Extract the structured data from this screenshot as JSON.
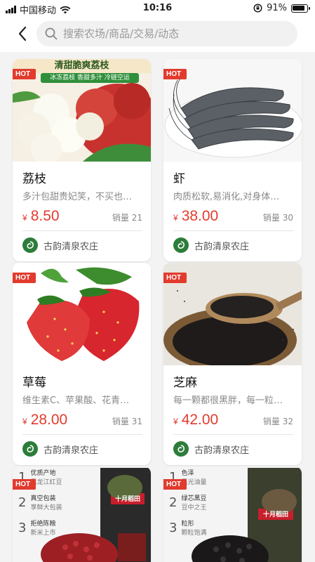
{
  "status_bar": {
    "carrier": "中国移动",
    "time": "10:16",
    "battery": "91%"
  },
  "header": {
    "search_placeholder": "搜索农场/商品/交易/动态"
  },
  "products": [
    {
      "badge": "HOT",
      "name": "荔枝",
      "desc": "多汁包甜贵妃笑，不买也…",
      "price_symbol": "¥",
      "price": "8.50",
      "sales": "销量 21",
      "farm": "古韵清泉农庄",
      "banner_title": "清甜脆爽荔枝",
      "banner_sub": "冰冻荔枝 香甜多汁 冷链空运"
    },
    {
      "badge": "HOT",
      "name": "虾",
      "desc": "肉质松软,易消化,对身体…",
      "price_symbol": "¥",
      "price": "38.00",
      "sales": "销量 30",
      "farm": "古韵清泉农庄"
    },
    {
      "badge": "HOT",
      "name": "草莓",
      "desc": "维生素C、苹果酸、花青…",
      "price_symbol": "¥",
      "price": "28.00",
      "sales": "销量 31",
      "farm": "古韵清泉农庄"
    },
    {
      "badge": "HOT",
      "name": "芝麻",
      "desc": "每一颗都很黑胖，每一粒…",
      "price_symbol": "¥",
      "price": "42.00",
      "sales": "销量 32",
      "farm": "古韵清泉农庄"
    },
    {
      "badge": "HOT",
      "pack_lines": [
        "优质产地",
        "黑龙江红豆",
        "真空包装",
        "享鲜大包装",
        "拒绝陈粮",
        "新米上市"
      ],
      "pack_nums": [
        "1",
        "2",
        "3"
      ],
      "pack_brand": "十月稻田"
    },
    {
      "badge": "HOT",
      "pack_lines": [
        "色泽",
        "黑光油量",
        "绿芯黑豆",
        "豆中之王",
        "粒形",
        "颗粒饱满"
      ],
      "pack_nums": [
        "1",
        "2",
        "3"
      ],
      "pack_brand": "十月稻田"
    }
  ]
}
